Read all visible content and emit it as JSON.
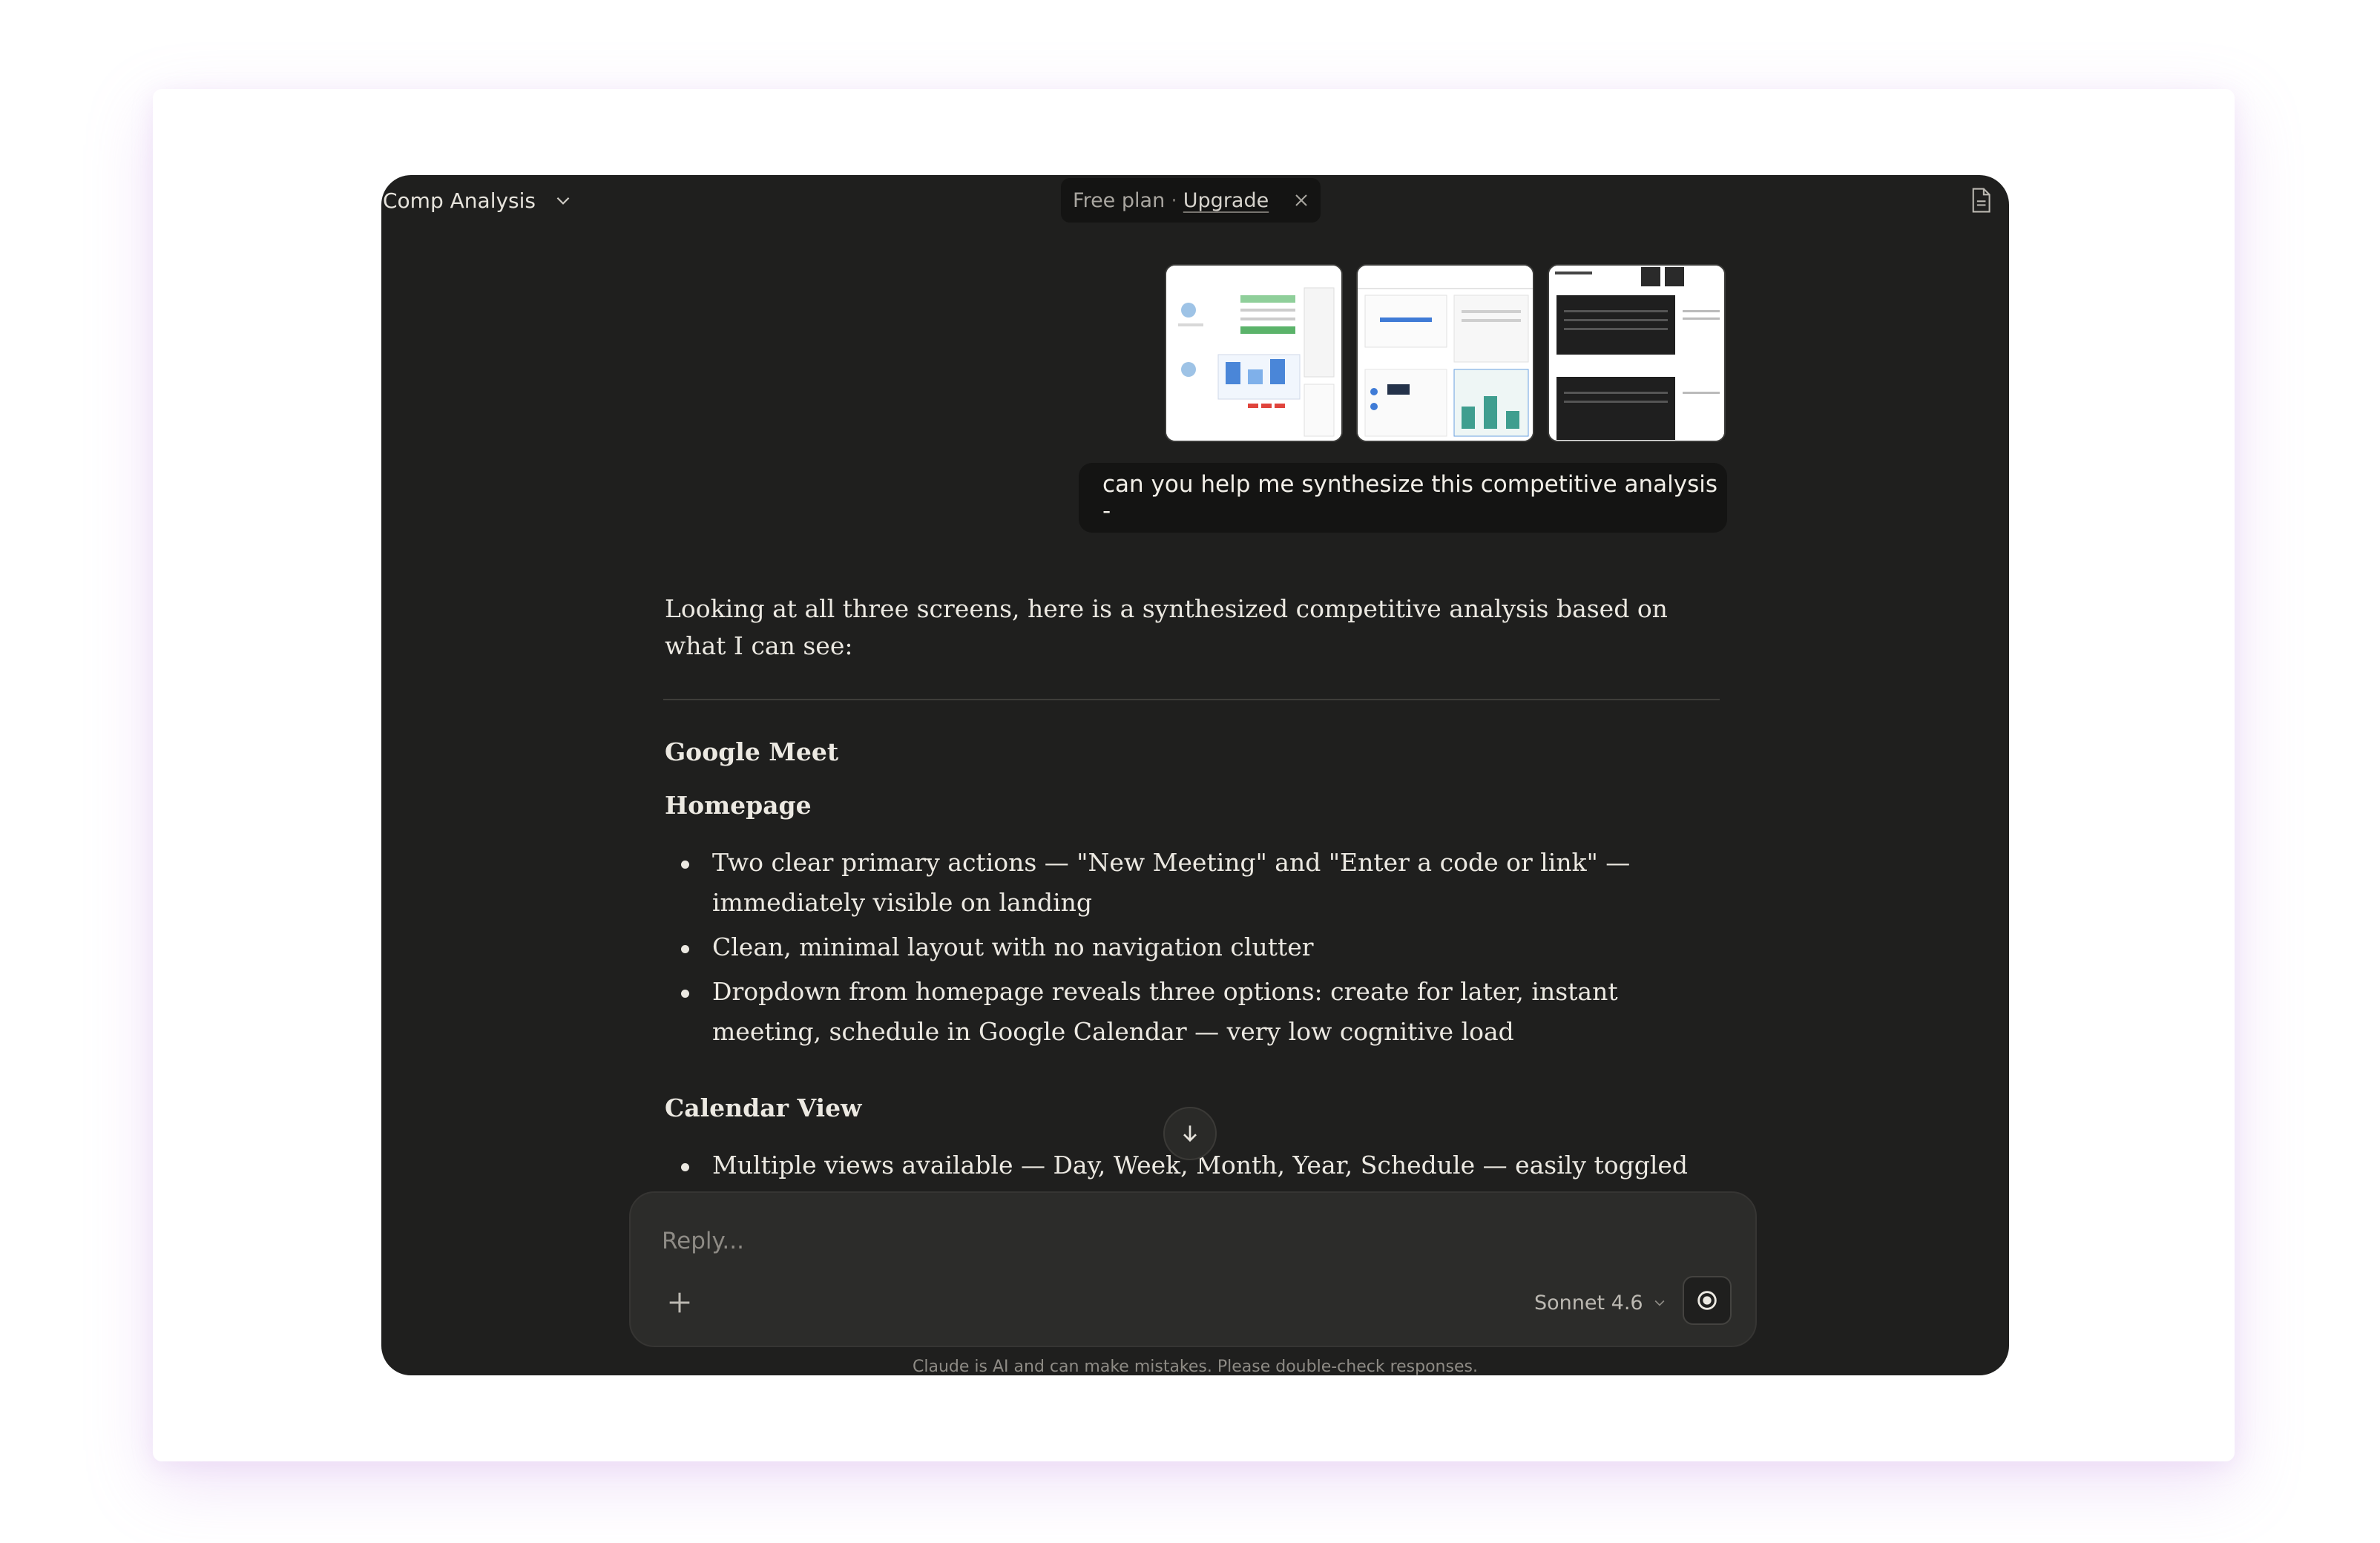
{
  "header": {
    "project_title": "Comp Analysis",
    "plan_label": "Free plan",
    "plan_separator": "·",
    "upgrade_label": "Upgrade"
  },
  "conversation": {
    "attachments": [
      "screenshot-1",
      "screenshot-2",
      "screenshot-3"
    ],
    "user_message": "can you help me synthesize this competitive analysis -",
    "response": {
      "intro": "Looking at all three screens, here is a synthesized competitive analysis based on what I can see:",
      "section_title": "Google Meet",
      "subsection_1": "Homepage",
      "subsection_1_bullets": [
        "Two clear primary actions — \"New Meeting\" and \"Enter a code or link\" — immediately visible on landing",
        "Clean, minimal layout with no navigation clutter",
        "Dropdown from homepage reveals three options: create for later, instant meeting, schedule in Google Calendar — very low cognitive load"
      ],
      "subsection_2": "Calendar View",
      "subsection_2_bullets": [
        "Multiple views available — Day, Week, Month, Year, Schedule — easily toggled"
      ]
    }
  },
  "composer": {
    "placeholder": "Reply...",
    "model_label": "Sonnet 4.6"
  },
  "footer": {
    "disclaimer": "Claude is AI and can make mistakes. Please double-check responses."
  },
  "colors": {
    "window_bg": "#1f1f1e",
    "bubble_bg": "#141413",
    "composer_bg": "#2c2c2a",
    "text_primary": "#ece9e2"
  }
}
